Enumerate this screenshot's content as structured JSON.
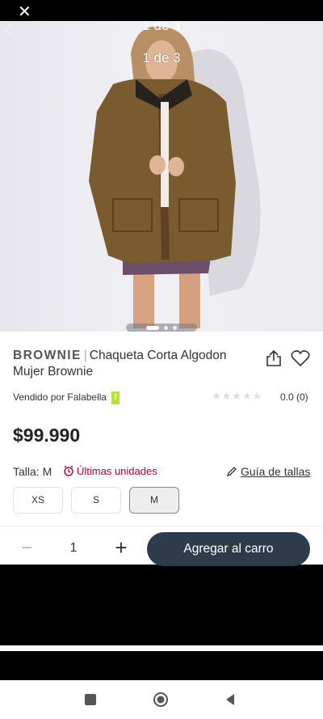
{
  "gallery": {
    "counter_ghost": "1 de 3",
    "counter": "1 de 3"
  },
  "product": {
    "brand": "BROWNIE",
    "separator": "|",
    "name": "Chaqueta Corta Algodon Mujer Brownie",
    "sold_by_label": "Vendido por",
    "seller": "Falabella",
    "seller_tag": "f",
    "stars": "★★★★★",
    "rating": "0.0 (0)",
    "price": "$99.990"
  },
  "size": {
    "label": "Talla: M",
    "alert": "Últimas unidades",
    "guide": "Guía de tallas",
    "options": [
      "XS",
      "S",
      "M"
    ],
    "selected": "M"
  },
  "cart": {
    "minus": "−",
    "quantity": "1",
    "plus": "+",
    "add_button": "Agregar al carro"
  },
  "colors": {
    "accent_button": "#2d3b4a",
    "alert": "#b00040",
    "seller_tag": "#b7e23a"
  }
}
